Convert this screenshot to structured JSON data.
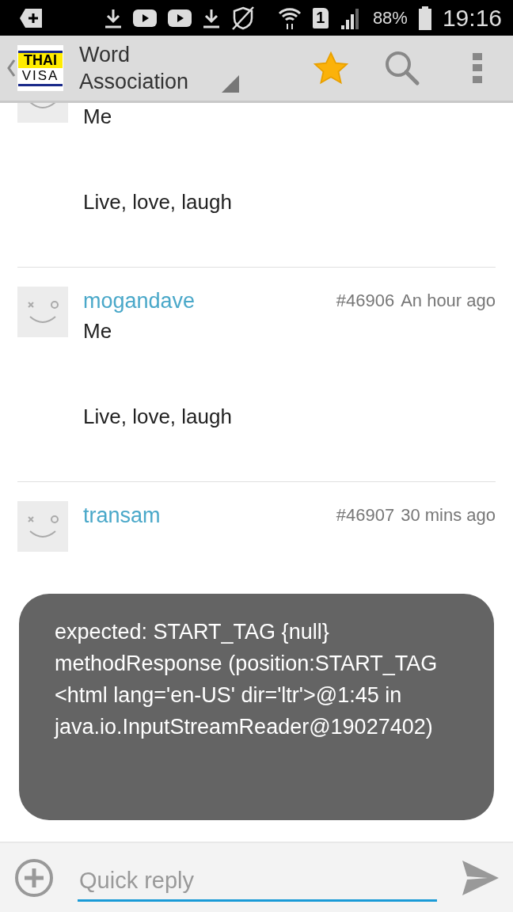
{
  "status_bar": {
    "battery_text": "88%",
    "sim": "1",
    "time": "19:16"
  },
  "toolbar": {
    "logo_top": "THAI",
    "logo_bottom": "VISA",
    "title": "Word Association",
    "favorite": true
  },
  "posts": [
    {
      "clipped": true,
      "lines": [
        "Me",
        "Live, love, laugh"
      ]
    },
    {
      "clipped": false,
      "username": "mogandave",
      "number": "#46906",
      "time": "An hour ago",
      "lines": [
        "Me",
        "Live, love, laugh"
      ]
    },
    {
      "clipped": false,
      "username": "transam",
      "number": "#46907",
      "time": "30 mins ago"
    }
  ],
  "toast": "expected: START_TAG {null} methodResponse (position:START_TAG <html lang='en-US' dir='ltr'>@1:45 in java.io.InputStreamReader@19027402)",
  "reply_bar": {
    "placeholder": "Quick reply"
  }
}
